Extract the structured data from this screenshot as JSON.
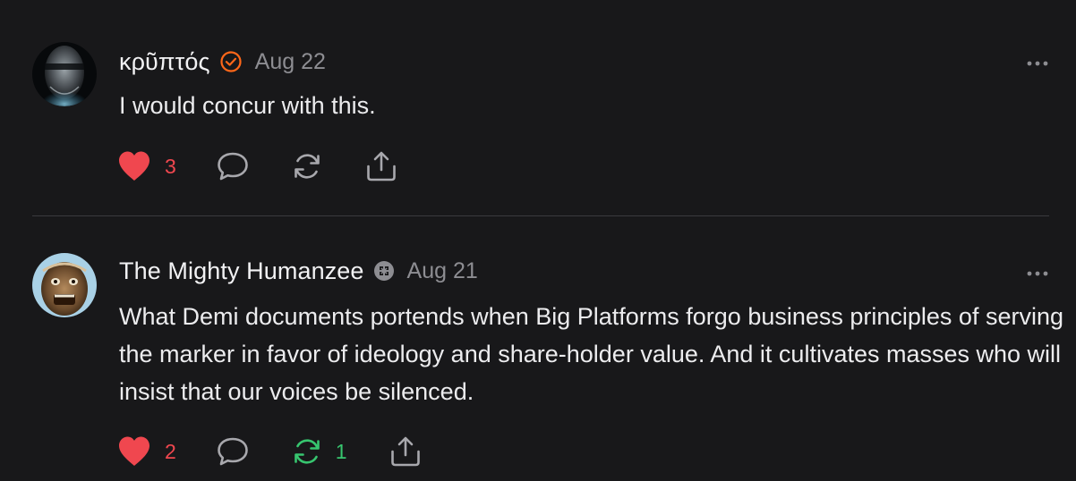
{
  "colors": {
    "background": "#18181a",
    "like_red": "#f0474f",
    "restack_green": "#37c56f",
    "verified_orange": "#ff6719",
    "muted": "#8d8d92"
  },
  "comments": [
    {
      "author": "κρῦπτός",
      "badge_icon": "verified-check-icon",
      "date": "Aug 22",
      "text": "I would concur with this.",
      "likes": "3",
      "restacks": "",
      "liked": true,
      "restacked": false
    },
    {
      "author": "The Mighty Humanzee",
      "badge_icon": "subscriber-badge-icon",
      "date": "Aug 21",
      "text": "What Demi documents portends when Big Platforms forgo business principles of serving the marker in favor of ideology and share-holder value. And it cultivates masses who will insist that our voices be silenced.",
      "likes": "2",
      "restacks": "1",
      "liked": true,
      "restacked": true
    }
  ]
}
